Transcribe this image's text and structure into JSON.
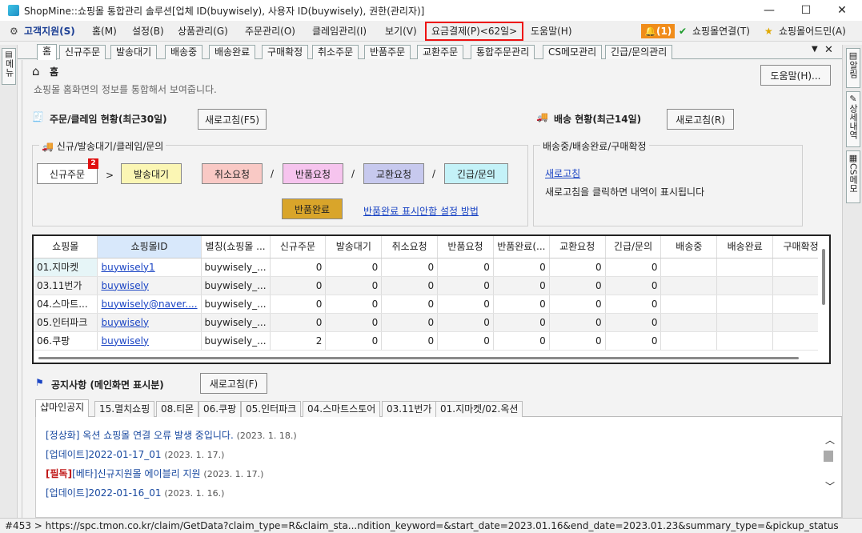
{
  "window": {
    "title": "ShopMine::쇼핑몰 통합관리 솔루션[업체 ID(buywisely), 사용자 ID(buywisely), 권한(관리자)]",
    "minimize": "—",
    "maximize": "☐",
    "close": "✕"
  },
  "menu": {
    "support": "고객지원(S)",
    "home": "홈(M)",
    "settings": "설정(B)",
    "products": "상품관리(G)",
    "orders": "주문관리(O)",
    "claims": "클레임관리(I)",
    "view": "보기(V)",
    "billing": "요금결제(P)<62일>",
    "help": "도움말(H)",
    "alarm": "(1)",
    "mall_connect": "쇼핑몰연결(T)",
    "mall_admin": "쇼핑몰어드민(A)"
  },
  "side": {
    "left_menu": "메뉴",
    "right_tabs": [
      "알림",
      "상세내역",
      "CS메모"
    ]
  },
  "tabs": [
    "홈",
    "신규주문",
    "발송대기",
    "배송중",
    "배송완료",
    "구매확정",
    "취소주문",
    "반품주문",
    "교환주문",
    "통합주문관리",
    "CS메모관리",
    "긴급/문의관리"
  ],
  "home": {
    "title": "홈",
    "description": "쇼핑몰 홈화면의 정보를 통합해서 보여줍니다.",
    "help_button": "도움말(H)...",
    "order_section": {
      "title": "주문/클레임 현황(최근30일)",
      "refresh": "새로고침(F5)",
      "group_label": "신규/발송대기/클레임/문의",
      "new_order": "신규주문",
      "new_order_badge": "2",
      "awaiting": "발송대기",
      "cancel": "취소요청",
      "return_req": "반품요청",
      "exchange": "교환요청",
      "urgent": "긴급/문의",
      "return_done": "반품완료",
      "arrow": ">",
      "slash": "/",
      "settings_link": "반품완료 표시안함 설정 방법"
    },
    "delivery_section": {
      "title": "배송 현황(최근14일)",
      "refresh": "새로고침(R)",
      "group_label": "배송중/배송완료/구매확정",
      "refresh_link": "새로고침",
      "hint": "새로고침을 클릭하면 내역이 표시됩니다"
    }
  },
  "grid": {
    "columns": [
      "쇼핑몰",
      "쇼핑몰ID",
      "별칭(쇼핑몰 ...",
      "신규주문",
      "발송대기",
      "취소요청",
      "반품요청",
      "반품완료(...",
      "교환요청",
      "긴급/문의",
      "배송중",
      "배송완료",
      "구매확정"
    ],
    "rows": [
      [
        "01.지마켓",
        "buywisely1",
        "buywisely_...",
        "0",
        "0",
        "0",
        "0",
        "0",
        "0",
        "0",
        "",
        "",
        ""
      ],
      [
        "03.11번가",
        "buywisely",
        "buywisely_...",
        "0",
        "0",
        "0",
        "0",
        "0",
        "0",
        "0",
        "",
        "",
        ""
      ],
      [
        "04.스마트...",
        "buywisely@naver....",
        "buywisely_...",
        "0",
        "0",
        "0",
        "0",
        "0",
        "0",
        "0",
        "",
        "",
        ""
      ],
      [
        "05.인터파크",
        "buywisely",
        "buywisely_...",
        "0",
        "0",
        "0",
        "0",
        "0",
        "0",
        "0",
        "",
        "",
        ""
      ],
      [
        "06.쿠팡",
        "buywisely",
        "buywisely_...",
        "2",
        "0",
        "0",
        "0",
        "0",
        "0",
        "0",
        "",
        "",
        ""
      ]
    ]
  },
  "notice": {
    "title": "공지사항 (메인화면 표시분)",
    "refresh": "새로고침(F)",
    "tabs": [
      "샵마인공지",
      "15.멸치쇼핑",
      "08.티몬",
      "06.쿠팡",
      "05.인터파크",
      "04.스마트스토어",
      "03.11번가",
      "01.지마켓/02.옥션"
    ],
    "items": [
      {
        "tag": "[정상화]",
        "text": " 옥션 쇼핑몰 연결 오류 발생 중입니다.",
        "date": "(2023. 1. 18.)"
      },
      {
        "tag": "[업데이트]",
        "text": "2022-01-17_01",
        "date": "(2023. 1. 17.)"
      },
      {
        "tag": "[필독]",
        "text": "[베타]신규지원몰 에이블리 지원",
        "date": "(2023. 1. 17.)"
      },
      {
        "tag": "[업데이트]",
        "text": "2022-01-16_01",
        "date": "(2023. 1. 16.)"
      }
    ]
  },
  "status": "#453 > https://spc.tmon.co.kr/claim/GetData?claim_type=R&claim_sta...ndition_keyword=&start_date=2023.01.16&end_date=2023.01.23&summary_type=&pickup_status",
  "colors": {
    "accent_link": "#1a44c4",
    "billing_border": "#e11111",
    "alarm": "#f08c1a",
    "badge": "#e01010"
  }
}
